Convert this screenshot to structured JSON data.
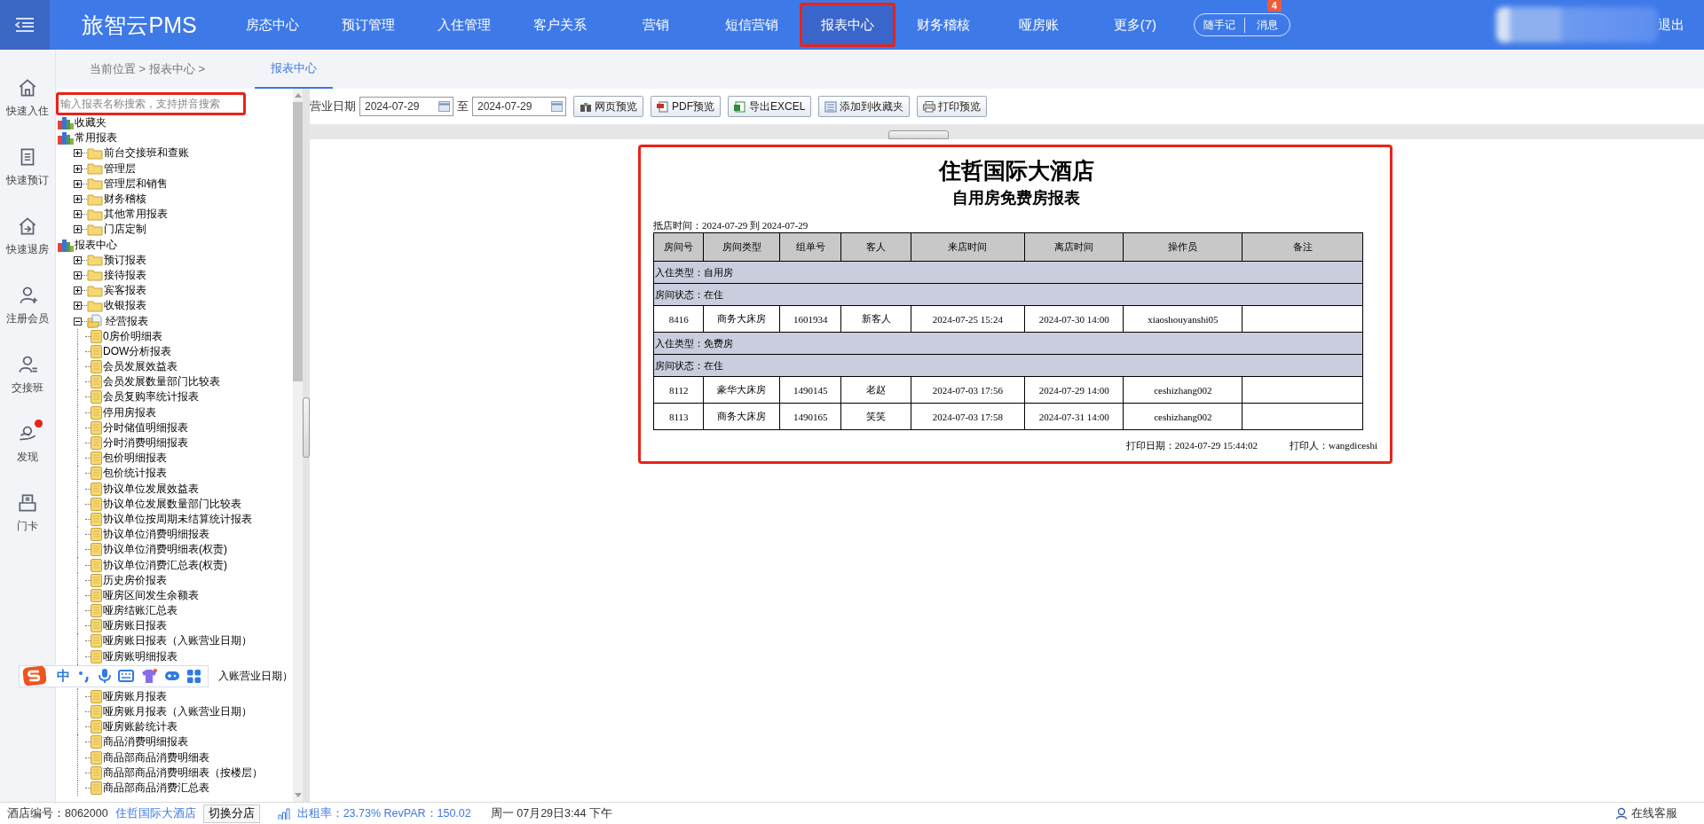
{
  "topbar": {
    "logo": "旅智云PMS",
    "nav": [
      {
        "label": "房态中心",
        "selected": false,
        "highlighted": false
      },
      {
        "label": "预订管理",
        "selected": false,
        "highlighted": false
      },
      {
        "label": "入住管理",
        "selected": false,
        "highlighted": false
      },
      {
        "label": "客户关系",
        "selected": false,
        "highlighted": false
      },
      {
        "label": "营销",
        "selected": false,
        "highlighted": false
      },
      {
        "label": "短信营销",
        "selected": false,
        "highlighted": false
      },
      {
        "label": "报表中心",
        "selected": true,
        "highlighted": true
      },
      {
        "label": "财务稽核",
        "selected": false,
        "highlighted": false
      },
      {
        "label": "哑房账",
        "selected": false,
        "highlighted": false
      },
      {
        "label": "更多(7)",
        "selected": false,
        "highlighted": false
      }
    ],
    "pill": [
      "随手记",
      "消息"
    ],
    "badge": "4",
    "logout": "退出"
  },
  "breadcrumb": {
    "path": "当前位置 > 报表中心 >",
    "tabs": [
      {
        "label": "报表中心",
        "selected": true
      }
    ]
  },
  "rail": [
    {
      "label": "快速入住",
      "dot": false
    },
    {
      "label": "快速预订",
      "dot": false
    },
    {
      "label": "快速退房",
      "dot": false
    },
    {
      "label": "注册会员",
      "dot": false
    },
    {
      "label": "交接班",
      "dot": false
    },
    {
      "label": "发现",
      "dot": true
    },
    {
      "label": "门卡",
      "dot": false
    }
  ],
  "search": {
    "placeholder": "输入报表名称搜索，支持拼音搜索",
    "highlighted": true
  },
  "tree": [
    {
      "label": "收藏夹",
      "kind": "root"
    },
    {
      "label": "常用报表",
      "kind": "root",
      "children": [
        {
          "label": "前台交接班和查账",
          "kind": "folder",
          "expanded": false
        },
        {
          "label": "管理层",
          "kind": "folder",
          "expanded": false
        },
        {
          "label": "管理层和销售",
          "kind": "folder",
          "expanded": false
        },
        {
          "label": "财务稽核",
          "kind": "folder",
          "expanded": false
        },
        {
          "label": "其他常用报表",
          "kind": "folder",
          "expanded": false
        },
        {
          "label": "门店定制",
          "kind": "folder",
          "expanded": false
        }
      ]
    },
    {
      "label": "报表中心",
      "kind": "root",
      "children": [
        {
          "label": "预订报表",
          "kind": "folder",
          "expanded": false
        },
        {
          "label": "接待报表",
          "kind": "folder",
          "expanded": false
        },
        {
          "label": "宾客报表",
          "kind": "folder",
          "expanded": false
        },
        {
          "label": "收银报表",
          "kind": "folder",
          "expanded": false
        },
        {
          "label": "经营报表",
          "kind": "folder",
          "expanded": true,
          "children": [
            {
              "label": "0房价明细表",
              "kind": "file"
            },
            {
              "label": "DOW分析报表",
              "kind": "file"
            },
            {
              "label": "会员发展效益表",
              "kind": "file"
            },
            {
              "label": "会员发展数量部门比较表",
              "kind": "file"
            },
            {
              "label": "会员复购率统计报表",
              "kind": "file"
            },
            {
              "label": "停用房报表",
              "kind": "file"
            },
            {
              "label": "分时储值明细报表",
              "kind": "file"
            },
            {
              "label": "分时消费明细报表",
              "kind": "file"
            },
            {
              "label": "包价明细报表",
              "kind": "file"
            },
            {
              "label": "包价统计报表",
              "kind": "file"
            },
            {
              "label": "协议单位发展效益表",
              "kind": "file"
            },
            {
              "label": "协议单位发展数量部门比较表",
              "kind": "file"
            },
            {
              "label": "协议单位按周期未结算统计报表",
              "kind": "file"
            },
            {
              "label": "协议单位消费明细报表",
              "kind": "file"
            },
            {
              "label": "协议单位消费明细表(权责)",
              "kind": "file"
            },
            {
              "label": "协议单位消费汇总表(权责)",
              "kind": "file"
            },
            {
              "label": "历史房价报表",
              "kind": "file"
            },
            {
              "label": "哑房区间发生余额表",
              "kind": "file"
            },
            {
              "label": "哑房结账汇总表",
              "kind": "file"
            },
            {
              "label": "哑房账日报表",
              "kind": "file"
            },
            {
              "label": "哑房账日报表（入账营业日期）",
              "kind": "file"
            },
            {
              "label": "哑房账明细报表",
              "kind": "file"
            },
            {
              "label": "入账营业日期）",
              "kind": "covered"
            },
            {
              "label": "哑房账月报表",
              "kind": "file"
            },
            {
              "label": "哑房账月报表（入账营业日期）",
              "kind": "file"
            },
            {
              "label": "哑房账龄统计表",
              "kind": "file"
            },
            {
              "label": "商品消费明细报表",
              "kind": "file"
            },
            {
              "label": "商品部商品消费明细表",
              "kind": "file"
            },
            {
              "label": "商品部商品消费明细表（按楼层）",
              "kind": "file"
            },
            {
              "label": "商品部商品消费汇总表",
              "kind": "file"
            }
          ]
        }
      ]
    }
  ],
  "ime_toolbar": {
    "label": "中"
  },
  "toolbar": {
    "date_label": "营业日期",
    "from": "2024-07-29",
    "to_label": "至",
    "to": "2024-07-29",
    "buttons": [
      "网页预览",
      "PDF预览",
      "导出EXCEL",
      "添加到收藏夹",
      "打印预览"
    ]
  },
  "report": {
    "highlighted": true,
    "hotel": "住哲国际大酒店",
    "title": "自用房免费房报表",
    "range": "抵店时间：2024-07-29 到 2024-07-29",
    "columns": [
      "房间号",
      "房间类型",
      "组单号",
      "客人",
      "来店时间",
      "离店时间",
      "操作员",
      "备注"
    ],
    "rows": [
      {
        "kind": "group",
        "text": "入住类型：自用房"
      },
      {
        "kind": "group",
        "text": "房间状态：在住"
      },
      {
        "kind": "data",
        "cells": [
          "8416",
          "商务大床房",
          "1601934",
          "新客人",
          "2024-07-25 15:24",
          "2024-07-30 14:00",
          "xiaoshouyanshi05",
          ""
        ]
      },
      {
        "kind": "group",
        "text": "入住类型：免费房"
      },
      {
        "kind": "group",
        "text": "房间状态：在住"
      },
      {
        "kind": "data",
        "cells": [
          "8112",
          "豪华大床房",
          "1490145",
          "老赵",
          "2024-07-03 17:56",
          "2024-07-29 14:00",
          "ceshizhang002",
          ""
        ]
      },
      {
        "kind": "data",
        "cells": [
          "8113",
          "商务大床房",
          "1490165",
          "笑笑",
          "2024-07-03 17:58",
          "2024-07-31 14:00",
          "ceshizhang002",
          ""
        ]
      }
    ],
    "print_date": "打印日期：2024-07-29 15:44:02",
    "printer": "打印人：wangdiceshi"
  },
  "status_bar": {
    "hotel_no": "酒店编号：8062000",
    "hotel": "住哲国际大酒店",
    "switch": "切换分店",
    "stats": "出租率：23.73% RevPAR：150.02",
    "date": "周一 07月29日3:44 下午",
    "service": "在线客服"
  }
}
